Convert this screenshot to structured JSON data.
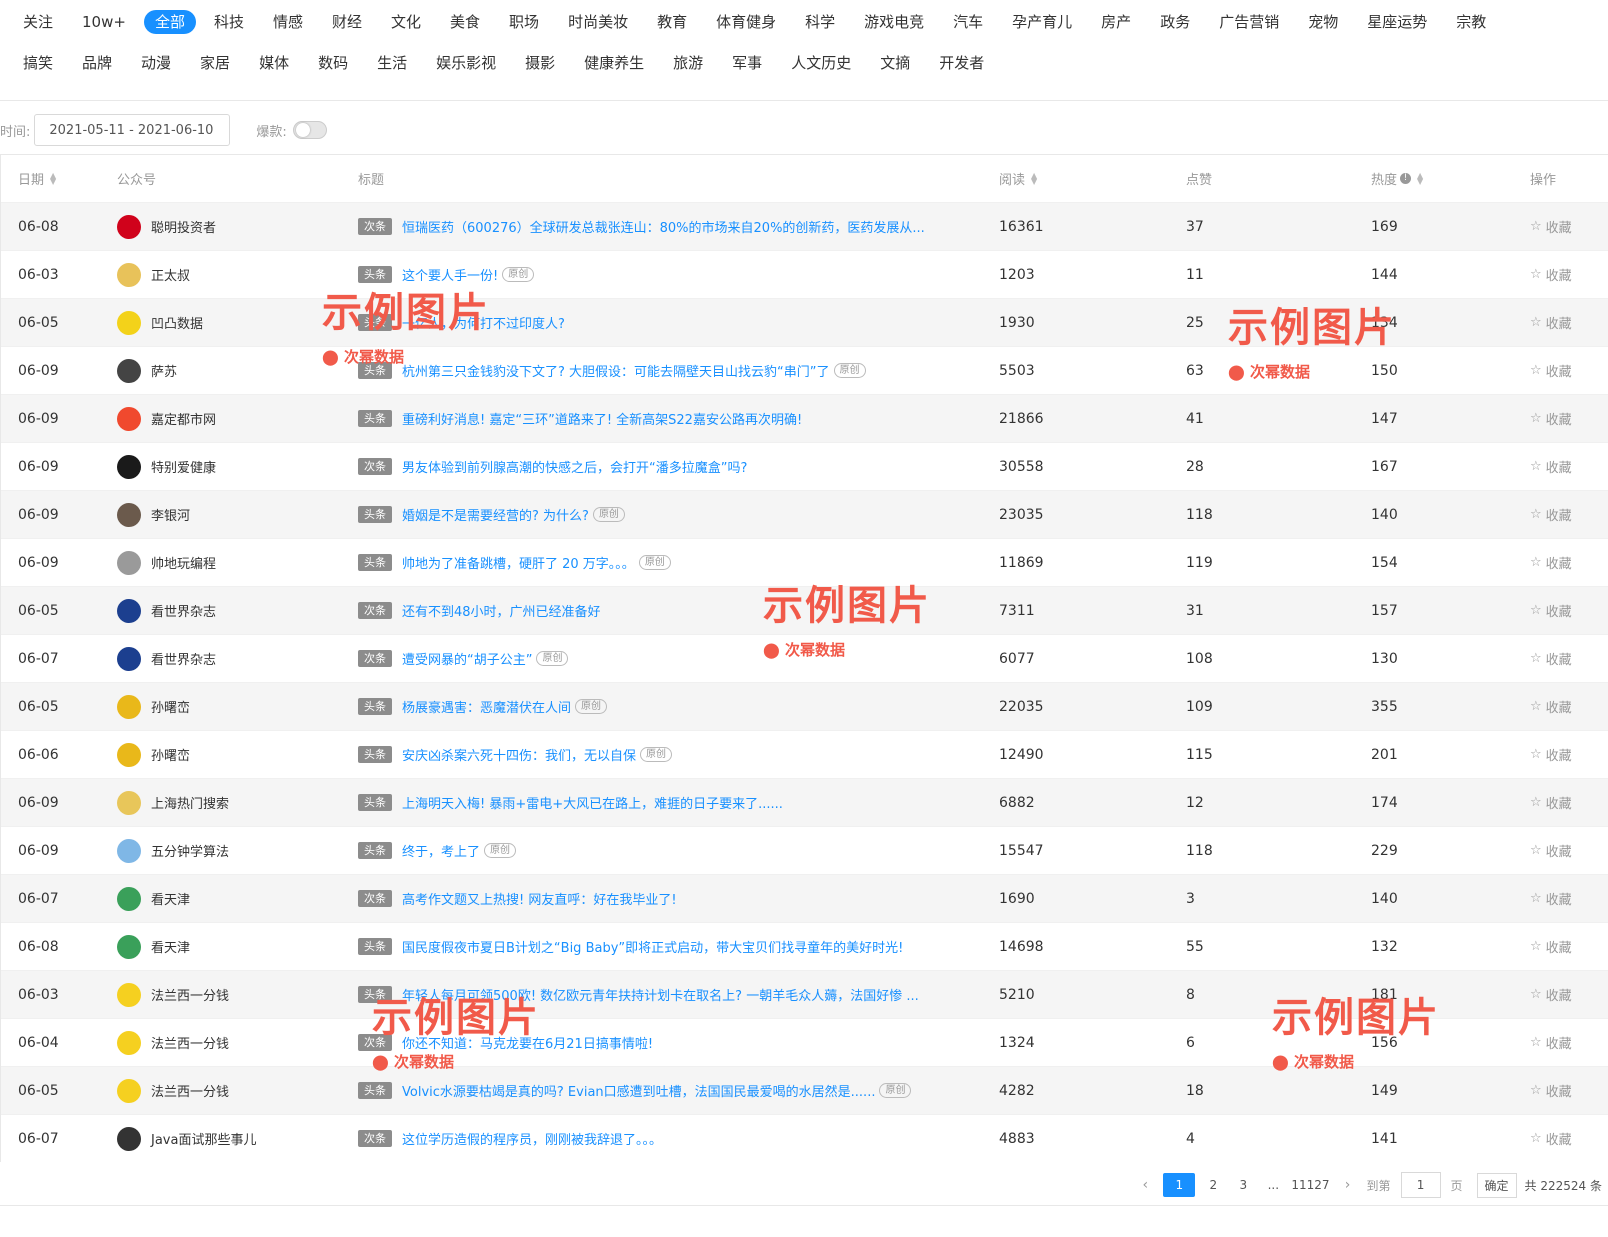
{
  "categories_row1": [
    "关注",
    "10w+",
    "全部",
    "科技",
    "情感",
    "财经",
    "文化",
    "美食",
    "职场",
    "时尚美妆",
    "教育",
    "体育健身",
    "科学",
    "游戏电竞",
    "汽车",
    "孕产育儿",
    "房产",
    "政务",
    "广告营销",
    "宠物",
    "星座运势",
    "宗教"
  ],
  "categories_row2": [
    "搞笑",
    "品牌",
    "动漫",
    "家居",
    "媒体",
    "数码",
    "生活",
    "娱乐影视",
    "摄影",
    "健康养生",
    "旅游",
    "军事",
    "人文历史",
    "文摘",
    "开发者"
  ],
  "active_category": "全部",
  "filters": {
    "time_label": "时间:",
    "date_range": "2021-05-11 - 2021-06-10",
    "hot_label": "爆款:"
  },
  "table_headers": {
    "date": "日期",
    "account": "公众号",
    "title": "标题",
    "read": "阅读",
    "like": "点赞",
    "heat": "热度",
    "op": "操作"
  },
  "fav_label": "收藏",
  "rows": [
    {
      "date": "06-08",
      "account": "聪明投资者",
      "tag": "次条",
      "title": "恒瑞医药（600276）全球研发总裁张连山：80%的市场来自20%的创新药，医药发展从...",
      "orig": "",
      "read": "16361",
      "like": "37",
      "heat": "169",
      "av": "#d0021b"
    },
    {
      "date": "06-03",
      "account": "正太叔",
      "tag": "头条",
      "title": "这个要人手一份!",
      "orig": "原创",
      "read": "1203",
      "like": "11",
      "heat": "144",
      "av": "#e8c25a"
    },
    {
      "date": "06-05",
      "account": "凹凸数据",
      "tag": "头条",
      "title": "一亿人，为何打不过印度人?",
      "orig": "",
      "read": "1930",
      "like": "25",
      "heat": "134",
      "av": "#f3d21a"
    },
    {
      "date": "06-09",
      "account": "萨苏",
      "tag": "头条",
      "title": "杭州第三只金钱豹没下文了? 大胆假设：可能去隔壁天目山找云豹“串门”了",
      "orig": "原创",
      "read": "5503",
      "like": "63",
      "heat": "150",
      "av": "#444444"
    },
    {
      "date": "06-09",
      "account": "嘉定都市网",
      "tag": "头条",
      "title": "重磅利好消息! 嘉定“三环”道路来了! 全新高架S22嘉安公路再次明确!",
      "orig": "",
      "read": "21866",
      "like": "41",
      "heat": "147",
      "av": "#f0492e"
    },
    {
      "date": "06-09",
      "account": "特别爱健康",
      "tag": "次条",
      "title": "男友体验到前列腺高潮的快感之后，会打开“潘多拉魔盒”吗?",
      "orig": "",
      "read": "30558",
      "like": "28",
      "heat": "167",
      "av": "#1a1a1a"
    },
    {
      "date": "06-09",
      "account": "李银河",
      "tag": "头条",
      "title": "婚姻是不是需要经营的? 为什么?",
      "orig": "原创",
      "read": "23035",
      "like": "118",
      "heat": "140",
      "av": "#6b5a4c"
    },
    {
      "date": "06-09",
      "account": "帅地玩编程",
      "tag": "头条",
      "title": "帅地为了准备跳槽，硬肝了 20 万字。。。",
      "orig": "原创",
      "read": "11869",
      "like": "119",
      "heat": "154",
      "av": "#9a9a9a"
    },
    {
      "date": "06-05",
      "account": "看世界杂志",
      "tag": "次条",
      "title": "还有不到48小时，广州已经准备好",
      "orig": "",
      "read": "7311",
      "like": "31",
      "heat": "157",
      "av": "#1c3f8f"
    },
    {
      "date": "06-07",
      "account": "看世界杂志",
      "tag": "次条",
      "title": "遭受网暴的“胡子公主”",
      "orig": "原创",
      "read": "6077",
      "like": "108",
      "heat": "130",
      "av": "#1c3f8f"
    },
    {
      "date": "06-05",
      "account": "孙曙峦",
      "tag": "头条",
      "title": "杨展豪遇害：恶魔潜伏在人间",
      "orig": "原创",
      "read": "22035",
      "like": "109",
      "heat": "355",
      "av": "#e9b81a"
    },
    {
      "date": "06-06",
      "account": "孙曙峦",
      "tag": "头条",
      "title": "安庆凶杀案六死十四伤：我们，无以自保",
      "orig": "原创",
      "read": "12490",
      "like": "115",
      "heat": "201",
      "av": "#e9b81a"
    },
    {
      "date": "06-09",
      "account": "上海热门搜索",
      "tag": "头条",
      "title": "上海明天入梅! 暴雨+雷电+大风已在路上，难捱的日子要来了......",
      "orig": "",
      "read": "6882",
      "like": "12",
      "heat": "174",
      "av": "#e8c65a"
    },
    {
      "date": "06-09",
      "account": "五分钟学算法",
      "tag": "头条",
      "title": "终于，考上了",
      "orig": "原创",
      "read": "15547",
      "like": "118",
      "heat": "229",
      "av": "#7fb7e6"
    },
    {
      "date": "06-07",
      "account": "看天津",
      "tag": "次条",
      "title": "高考作文题又上热搜! 网友直呼：好在我毕业了!",
      "orig": "",
      "read": "1690",
      "like": "3",
      "heat": "140",
      "av": "#3aa05a"
    },
    {
      "date": "06-08",
      "account": "看天津",
      "tag": "头条",
      "title": "国民度假夜市夏日B计划之“Big Baby”即将正式启动，带大宝贝们找寻童年的美好时光!",
      "orig": "",
      "read": "14698",
      "like": "55",
      "heat": "132",
      "av": "#3aa05a"
    },
    {
      "date": "06-03",
      "account": "法兰西一分钱",
      "tag": "头条",
      "title": "年轻人每月可领500欧! 数亿欧元青年扶持计划卡在取名上? 一朝羊毛众人薅，法国好惨 ...",
      "orig": "",
      "read": "5210",
      "like": "8",
      "heat": "181",
      "av": "#f5d020"
    },
    {
      "date": "06-04",
      "account": "法兰西一分钱",
      "tag": "次条",
      "title": "你还不知道：马克龙要在6月21日搞事情啦!",
      "orig": "",
      "read": "1324",
      "like": "6",
      "heat": "156",
      "av": "#f5d020"
    },
    {
      "date": "06-05",
      "account": "法兰西一分钱",
      "tag": "头条",
      "title": "Volvic水源要枯竭是真的吗? Evian口感遭到吐槽，法国国民最爱喝的水居然是......",
      "orig": "原创",
      "read": "4282",
      "like": "18",
      "heat": "149",
      "av": "#f5d020"
    },
    {
      "date": "06-07",
      "account": "Java面试那些事儿",
      "tag": "次条",
      "title": "这位学历造假的程序员，刚刚被我辞退了。。。",
      "orig": "",
      "read": "4883",
      "like": "4",
      "heat": "141",
      "av": "#333333"
    }
  ],
  "pagination": {
    "prev": "‹",
    "pages": [
      "1",
      "2",
      "3"
    ],
    "ellipsis": "...",
    "last": "11127",
    "next": "›",
    "goto_label": "到第",
    "goto_value": "1",
    "page_unit": "页",
    "confirm": "确定",
    "total": "共 222524 条"
  },
  "watermark": {
    "big": "示例图片",
    "small": "次幂数据"
  }
}
